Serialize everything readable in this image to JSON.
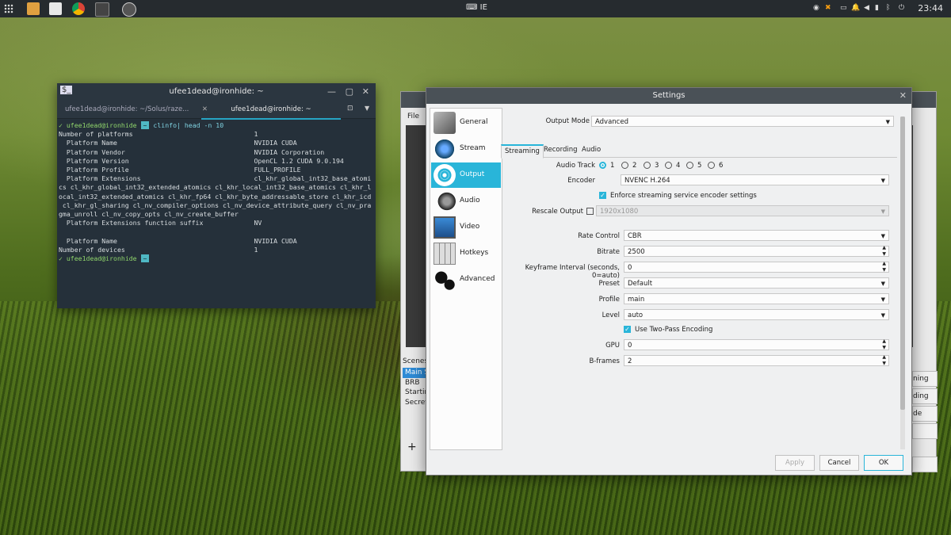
{
  "taskbar": {
    "keyboard_layout": "IE",
    "clock": "23:44"
  },
  "terminal": {
    "title": "ufee1dead@ironhide: ~",
    "tab_inactive": "ufee1dead@ironhide: ~/Solus/raze...",
    "tab_active": "ufee1dead@ironhide: ~",
    "prompt_user": "ufee1dead@ironhide",
    "prompt_dir": "~",
    "command": "clinfo| head -n 10",
    "output_lines": [
      "Number of platforms                               1",
      "  Platform Name                                   NVIDIA CUDA",
      "  Platform Vendor                                 NVIDIA Corporation",
      "  Platform Version                                OpenCL 1.2 CUDA 9.0.194",
      "  Platform Profile                                FULL_PROFILE",
      "  Platform Extensions                             cl_khr_global_int32_base_atomi",
      "cs cl_khr_global_int32_extended_atomics cl_khr_local_int32_base_atomics cl_khr_l",
      "ocal_int32_extended_atomics cl_khr_fp64 cl_khr_byte_addressable_store cl_khr_icd",
      " cl_khr_gl_sharing cl_nv_compiler_options cl_nv_device_attribute_query cl_nv_pra",
      "gma_unroll cl_nv_copy_opts cl_nv_create_buffer",
      "  Platform Extensions function suffix             NV",
      "",
      "  Platform Name                                   NVIDIA CUDA",
      "Number of devices                                 1"
    ]
  },
  "obs": {
    "menu_file": "File",
    "scenes_label": "Scenes",
    "scenes": [
      "Main S",
      "BRB",
      "Startin",
      "Secret"
    ],
    "add_label": "+",
    "right_buttons": [
      "ning",
      "ding",
      "de",
      "",
      "",
      ""
    ]
  },
  "settings": {
    "title": "Settings",
    "nav": [
      {
        "label": "General",
        "icon": "general-icon"
      },
      {
        "label": "Stream",
        "icon": "stream-icon"
      },
      {
        "label": "Output",
        "icon": "output-icon"
      },
      {
        "label": "Audio",
        "icon": "audio-icon"
      },
      {
        "label": "Video",
        "icon": "video-icon"
      },
      {
        "label": "Hotkeys",
        "icon": "hotkeys-icon"
      },
      {
        "label": "Advanced",
        "icon": "advanced-icon"
      }
    ],
    "selected_nav": "Output",
    "output_mode_label": "Output Mode",
    "output_mode_value": "Advanced",
    "tabs": [
      "Streaming",
      "Recording",
      "Audio"
    ],
    "selected_tab": "Streaming",
    "audio_track_label": "Audio Track",
    "audio_tracks": [
      "1",
      "2",
      "3",
      "4",
      "5",
      "6"
    ],
    "audio_track_selected": "1",
    "encoder_label": "Encoder",
    "encoder_value": "NVENC H.264",
    "enforce_label": "Enforce streaming service encoder settings",
    "enforce_checked": true,
    "rescale_label": "Rescale Output",
    "rescale_checked": false,
    "rescale_value": "1920x1080",
    "rate_control_label": "Rate Control",
    "rate_control_value": "CBR",
    "bitrate_label": "Bitrate",
    "bitrate_value": "2500",
    "keyframe_label": "Keyframe Interval (seconds, 0=auto)",
    "keyframe_value": "0",
    "preset_label": "Preset",
    "preset_value": "Default",
    "profile_label": "Profile",
    "profile_value": "main",
    "level_label": "Level",
    "level_value": "auto",
    "twopass_label": "Use Two-Pass Encoding",
    "twopass_checked": true,
    "gpu_label": "GPU",
    "gpu_value": "0",
    "bframes_label": "B-frames",
    "bframes_value": "2",
    "apply_label": "Apply",
    "cancel_label": "Cancel",
    "ok_label": "OK"
  }
}
